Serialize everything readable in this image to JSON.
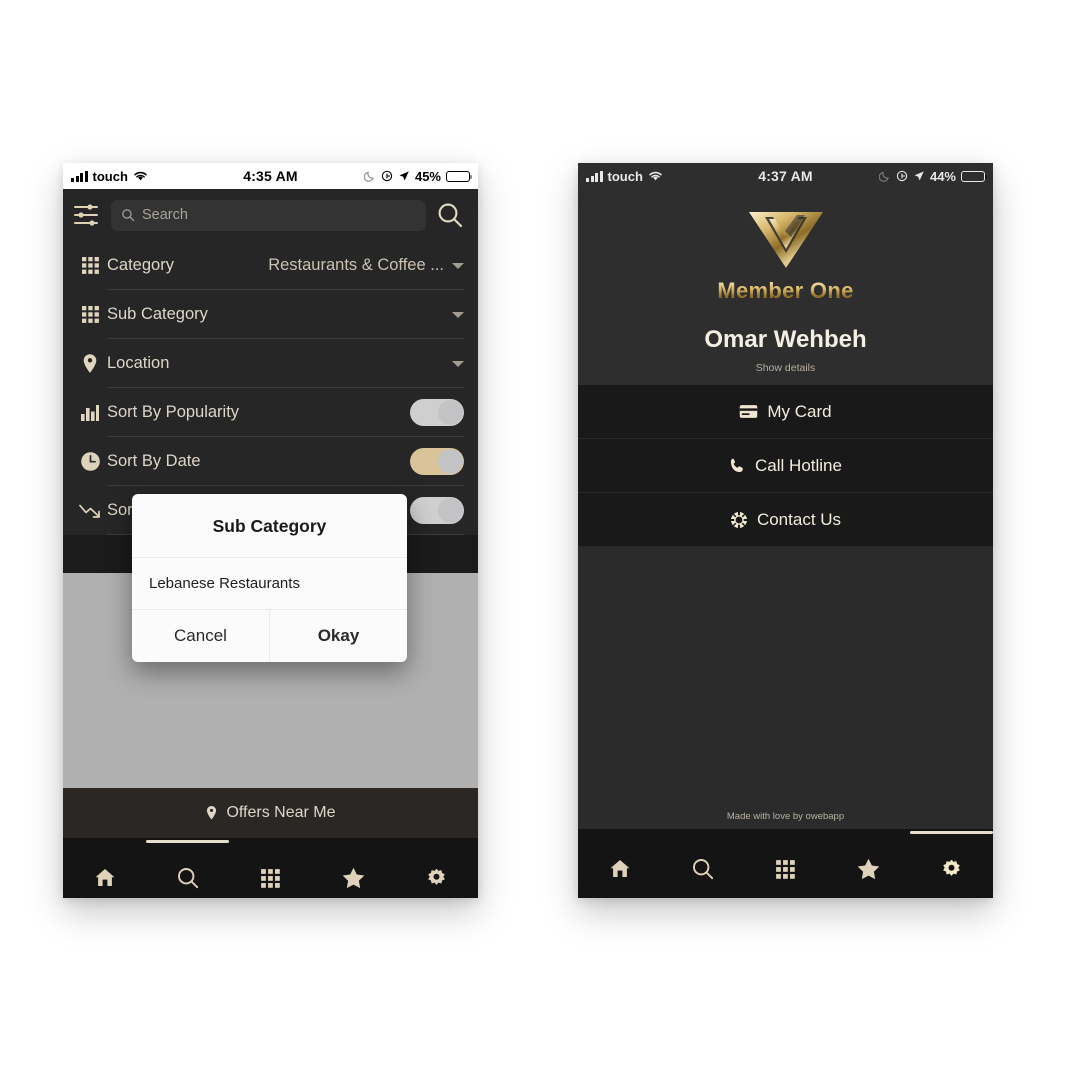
{
  "colors": {
    "gold": "#ddd0ae",
    "gold_bright": "#e8dcc0",
    "dark_bg": "#262626",
    "panel_bg": "#191919",
    "toggle_on": "#d9c49a",
    "toggle_off": "#cfcfcf"
  },
  "left_phone": {
    "status_bar": {
      "carrier": "touch",
      "time": "4:35 AM",
      "battery_percent": "45%",
      "icons": [
        "signal-bars-icon",
        "wifi-icon",
        "moon-icon",
        "rotation-lock-icon",
        "location-arrow-icon",
        "battery-icon"
      ]
    },
    "search": {
      "placeholder": "Search",
      "value": "",
      "filter_icon": "sliders-icon",
      "search_icon": "search-icon"
    },
    "filters": [
      {
        "icon": "grid-icon",
        "label": "Category",
        "value": "Restaurants & Coffee ...",
        "control": "dropdown"
      },
      {
        "icon": "grid-icon",
        "label": "Sub Category",
        "value": "",
        "control": "dropdown"
      },
      {
        "icon": "location-pin-icon",
        "label": "Location",
        "value": "",
        "control": "dropdown"
      },
      {
        "icon": "bar-chart-icon",
        "label": "Sort By Popularity",
        "value": "",
        "control": "toggle",
        "state": "off"
      },
      {
        "icon": "clock-icon",
        "label": "Sort By Date",
        "value": "",
        "control": "toggle",
        "state": "on"
      },
      {
        "icon": "trend-down-icon",
        "label": "Sort By Discount",
        "value": "",
        "control": "toggle",
        "state": "off"
      }
    ],
    "dialog": {
      "title": "Sub Category",
      "options": [
        "Lebanese Restaurants"
      ],
      "cancel_label": "Cancel",
      "okay_label": "Okay"
    },
    "offers_bar": {
      "label": "Offers Near Me",
      "icon": "location-pin-icon"
    },
    "tabs": [
      {
        "icon": "home-icon",
        "name": "home",
        "active": false
      },
      {
        "icon": "search-icon",
        "name": "search",
        "active": true
      },
      {
        "icon": "grid-icon",
        "name": "category",
        "active": false
      },
      {
        "icon": "star-icon",
        "name": "favorites",
        "active": false
      },
      {
        "icon": "gear-icon",
        "name": "settings",
        "active": false
      }
    ]
  },
  "right_phone": {
    "status_bar": {
      "carrier": "touch",
      "time": "4:37 AM",
      "battery_percent": "44%",
      "icons": [
        "signal-bars-icon",
        "wifi-icon",
        "moon-icon",
        "rotation-lock-icon",
        "location-arrow-icon",
        "battery-icon"
      ]
    },
    "brand": {
      "logo": "member-one-logo-icon",
      "name": "Member One"
    },
    "user": {
      "name": "Omar Wehbeh",
      "show_details_label": "Show details"
    },
    "menu": [
      {
        "icon": "credit-card-icon",
        "label": "My Card"
      },
      {
        "icon": "phone-icon",
        "label": "Call Hotline"
      },
      {
        "icon": "life-ring-icon",
        "label": "Contact Us"
      }
    ],
    "footer": {
      "text": "Made with love by owebapp"
    },
    "tabs": [
      {
        "icon": "home-icon",
        "name": "home",
        "active": false
      },
      {
        "icon": "search-icon",
        "name": "search",
        "active": false
      },
      {
        "icon": "grid-icon",
        "name": "category",
        "active": false
      },
      {
        "icon": "star-icon",
        "name": "favorites",
        "active": false
      },
      {
        "icon": "gear-icon",
        "name": "settings",
        "active": true
      }
    ]
  }
}
